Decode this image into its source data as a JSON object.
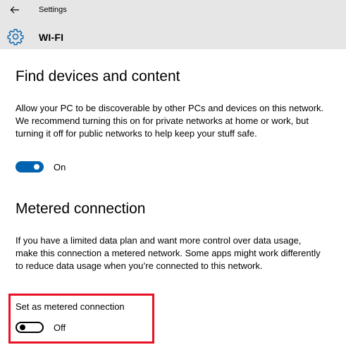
{
  "header": {
    "app_title": "Settings",
    "page_title": "WI-FI"
  },
  "find_devices": {
    "heading": "Find devices and content",
    "description": "Allow your PC to be discoverable by other PCs and devices on this network. We recommend turning this on for private networks at home or work, but turning it off for public networks to help keep your stuff safe.",
    "toggle": {
      "state": "on",
      "label": "On"
    }
  },
  "metered": {
    "heading": "Metered connection",
    "description": "If you have a limited data plan and want more control over data usage, make this connection a metered network. Some apps might work differently to reduce data usage when you’re connected to this network.",
    "setting_label": "Set as metered connection",
    "toggle": {
      "state": "off",
      "label": "Off"
    }
  },
  "colors": {
    "accent": "#0063b1",
    "header_bg": "#e6e6e6",
    "highlight": "#e81123"
  },
  "icons": {
    "back": "back-arrow-icon",
    "settings": "gear-icon"
  }
}
